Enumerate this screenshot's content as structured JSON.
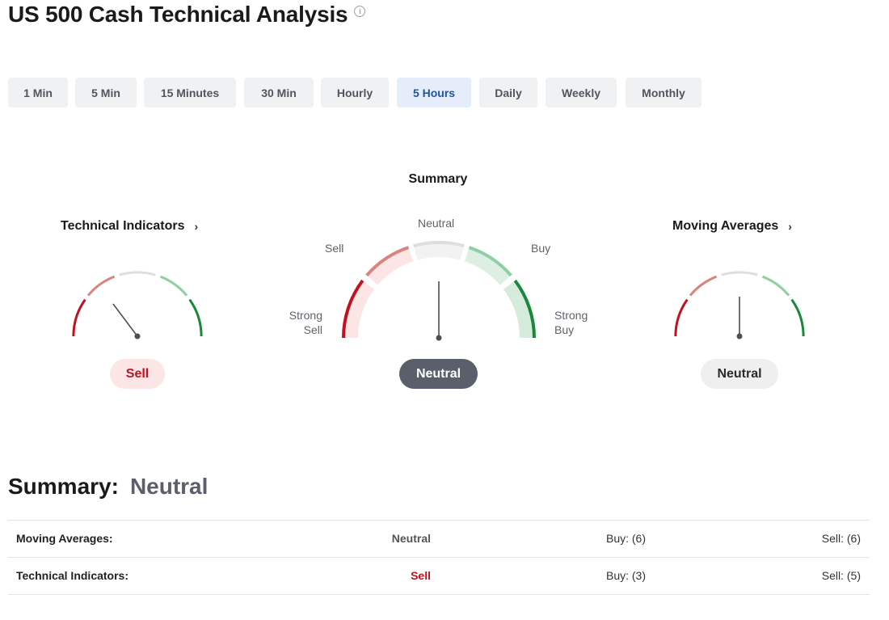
{
  "page": {
    "title": "US 500 Cash Technical Analysis",
    "info_icon": "i"
  },
  "timeframes": [
    {
      "label": "1 Min",
      "active": false
    },
    {
      "label": "5 Min",
      "active": false
    },
    {
      "label": "15 Minutes",
      "active": false
    },
    {
      "label": "30 Min",
      "active": false
    },
    {
      "label": "Hourly",
      "active": false
    },
    {
      "label": "5 Hours",
      "active": true
    },
    {
      "label": "Daily",
      "active": false
    },
    {
      "label": "Weekly",
      "active": false
    },
    {
      "label": "Monthly",
      "active": false
    }
  ],
  "gauges": {
    "summary": {
      "title": "Summary",
      "labels": {
        "strong_sell_1": "Strong",
        "strong_sell_2": "Sell",
        "sell": "Sell",
        "neutral": "Neutral",
        "buy": "Buy",
        "strong_buy_1": "Strong",
        "strong_buy_2": "Buy"
      },
      "result": "Neutral"
    },
    "technical_indicators": {
      "title": "Technical Indicators",
      "chevron": "›",
      "result": "Sell"
    },
    "moving_averages": {
      "title": "Moving Averages",
      "chevron": "›",
      "result": "Neutral"
    }
  },
  "colors": {
    "strong_sell": "#c1121f",
    "sell": "#d9847f",
    "neutral": "#dedede",
    "buy": "#8fcfa4",
    "strong_buy": "#178a3a",
    "needle": "#4a4e57"
  },
  "summary": {
    "label": "Summary:",
    "value": "Neutral",
    "rows": [
      {
        "name": "Moving Averages:",
        "signal": "Neutral",
        "buy": "Buy: (6)",
        "sell": "Sell: (6)"
      },
      {
        "name": "Technical Indicators:",
        "signal": "Sell",
        "buy": "Buy: (3)",
        "sell": "Sell: (5)"
      }
    ]
  }
}
